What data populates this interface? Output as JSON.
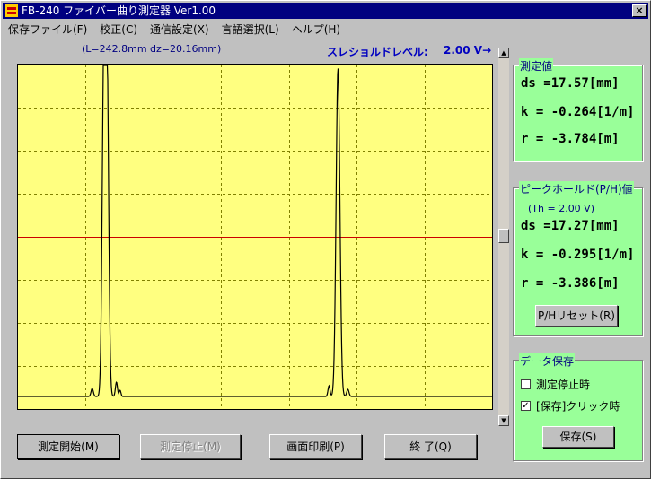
{
  "window": {
    "title": "FB-240 ファイバー曲り測定器  Ver1.00",
    "close_glyph": "×"
  },
  "menu": [
    {
      "label": "保存ファイル(F)"
    },
    {
      "label": "校正(C)"
    },
    {
      "label": "通信設定(X)"
    },
    {
      "label": "言語選択(L)"
    },
    {
      "label": "ヘルプ(H)"
    }
  ],
  "info": {
    "length_text": "(L=242.8mm dz=20.16mm)"
  },
  "threshold": {
    "label": "スレショルドレベル:",
    "value": "2.00 V→"
  },
  "plot": {
    "background": "#ffff80",
    "grid_color": "#808000",
    "trace_color": "#000000",
    "threshold_color": "#cc0000",
    "vertical_divisions": 7,
    "horizontal_divisions": 8,
    "threshold_level_fraction": 0.5,
    "peak1_center_fraction": 0.185,
    "peak2_center_fraction": 0.675
  },
  "scrollbar": {
    "up_glyph": "▲",
    "down_glyph": "▼"
  },
  "buttons": {
    "start": "測定開始(M)",
    "stop": "測定停止(M)",
    "print": "画面印刷(P)",
    "exit": "終 了(Q)"
  },
  "measure_panel": {
    "title": "測定値",
    "ds": "ds =17.57[mm]",
    "k": "k = -0.264[1/m]",
    "r": "r = -3.784[m]"
  },
  "peak_panel": {
    "title": "ピークホールド(P/H)値",
    "note": "(Th = 2.00 V)",
    "ds": "ds =17.27[mm]",
    "k": "k = -0.295[1/m]",
    "r": "r = -3.386[m]",
    "reset_button": "P/Hリセット(R)"
  },
  "save_panel": {
    "title": "データ保存",
    "opt1": "測定停止時",
    "opt2": "[保存]クリック時",
    "opt1_checked": false,
    "opt2_checked": true,
    "check_glyph": "✓",
    "save_button": "保存(S)"
  },
  "colors": {
    "titlebar": "#000080",
    "panel_bg": "#99ff99",
    "highlight_text": "#0000c0"
  }
}
